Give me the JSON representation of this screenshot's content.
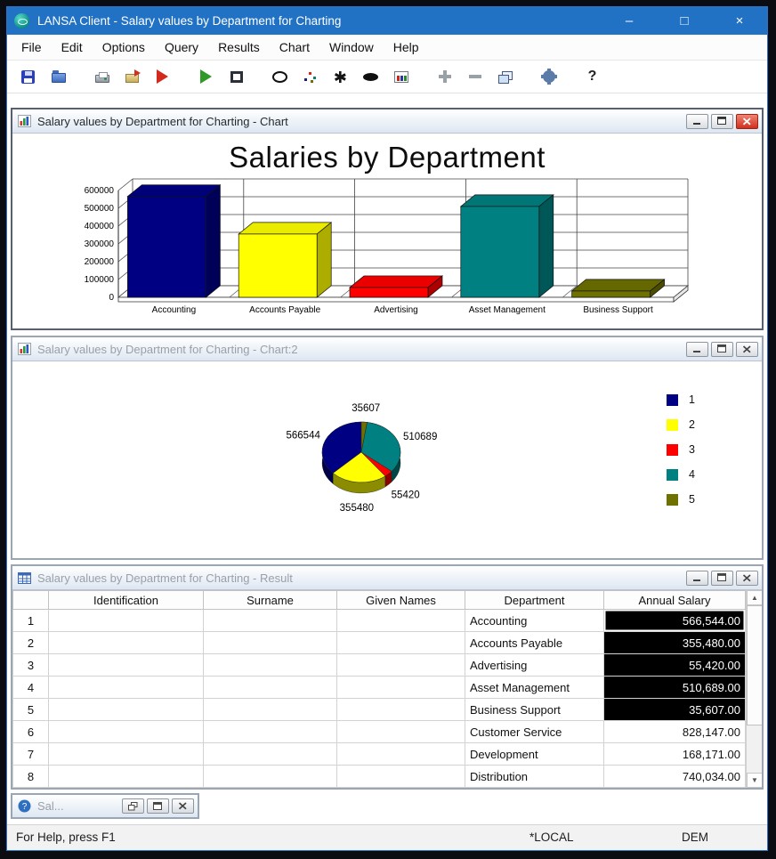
{
  "window": {
    "title": "LANSA Client - Salary values by Department for Charting",
    "buttons": {
      "minimize": "–",
      "maximize": "□",
      "close": "×"
    }
  },
  "menu_bar": {
    "items": [
      "File",
      "Edit",
      "Options",
      "Query",
      "Results",
      "Chart",
      "Window",
      "Help"
    ]
  },
  "toolbar": {
    "items": [
      {
        "name": "save",
        "icon": "floppy-icon"
      },
      {
        "name": "open",
        "icon": "folder-open-icon"
      },
      {
        "separator": true
      },
      {
        "name": "print",
        "icon": "printer-icon"
      },
      {
        "name": "export",
        "icon": "folder-export-icon"
      },
      {
        "name": "run-query",
        "icon": "run-triangle-icon"
      },
      {
        "separator": true
      },
      {
        "name": "play",
        "icon": "play-icon"
      },
      {
        "name": "stop",
        "icon": "stop-icon"
      },
      {
        "separator": true
      },
      {
        "name": "circle-chart",
        "icon": "circle-icon"
      },
      {
        "name": "scatter-chart",
        "icon": "scatter-icon"
      },
      {
        "name": "star-chart",
        "icon": "asterisk-icon"
      },
      {
        "name": "ellipse-chart",
        "icon": "ellipse-icon"
      },
      {
        "name": "chart-slide",
        "icon": "chart-slide-icon"
      },
      {
        "separator": true
      },
      {
        "name": "zoom-in",
        "icon": "plus-icon"
      },
      {
        "name": "zoom-out",
        "icon": "minus-icon"
      },
      {
        "name": "cascade",
        "icon": "cascade-icon"
      },
      {
        "separator": true
      },
      {
        "name": "settings",
        "icon": "gear-icon"
      },
      {
        "separator": true
      },
      {
        "name": "help",
        "icon": "question-icon"
      }
    ]
  },
  "chart_window": {
    "title": "Salary values by Department for Charting - Chart"
  },
  "chart2_window": {
    "title": "Salary values by Department for Charting - Chart:2"
  },
  "result_window": {
    "title": "Salary values by Department for Charting - Result",
    "columns": [
      "Identification",
      "Surname",
      "Given Names",
      "Department",
      "Annual Salary"
    ],
    "rows": [
      {
        "num": "1",
        "identification": "",
        "surname": "",
        "given_names": "",
        "department": "Accounting",
        "annual_salary": "566,544.00",
        "selected": true,
        "focused": true
      },
      {
        "num": "2",
        "identification": "",
        "surname": "",
        "given_names": "",
        "department": "Accounts Payable",
        "annual_salary": "355,480.00",
        "selected": true
      },
      {
        "num": "3",
        "identification": "",
        "surname": "",
        "given_names": "",
        "department": "Advertising",
        "annual_salary": "55,420.00",
        "selected": true
      },
      {
        "num": "4",
        "identification": "",
        "surname": "",
        "given_names": "",
        "department": "Asset Management",
        "annual_salary": "510,689.00",
        "selected": true
      },
      {
        "num": "5",
        "identification": "",
        "surname": "",
        "given_names": "",
        "department": "Business Support",
        "annual_salary": "35,607.00",
        "selected": true
      },
      {
        "num": "6",
        "identification": "",
        "surname": "",
        "given_names": "",
        "department": "Customer Service",
        "annual_salary": "828,147.00",
        "selected": false
      },
      {
        "num": "7",
        "identification": "",
        "surname": "",
        "given_names": "",
        "department": "Development",
        "annual_salary": "168,171.00",
        "selected": false
      },
      {
        "num": "8",
        "identification": "",
        "surname": "",
        "given_names": "",
        "department": "Distribution",
        "annual_salary": "740,034.00",
        "selected": false
      }
    ]
  },
  "minimized_window": {
    "title": "Sal..."
  },
  "status_bar": {
    "help_text": "For Help, press F1",
    "server": "*LOCAL",
    "partition": "DEM"
  },
  "chart_data": [
    {
      "type": "bar",
      "title": "Salaries by Department",
      "categories": [
        "Accounting",
        "Accounts Payable",
        "Advertising",
        "Asset Management",
        "Business Support"
      ],
      "values": [
        566544,
        355480,
        55420,
        510689,
        35607
      ],
      "colors": [
        "#000082",
        "#ffff00",
        "#ff0000",
        "#008080",
        "#6e7000"
      ],
      "xlabel": "",
      "ylabel": "",
      "ylim": [
        0,
        600000
      ],
      "yticks": [
        0,
        100000,
        200000,
        300000,
        400000,
        500000,
        600000
      ],
      "grid": true,
      "legend_position": "none"
    },
    {
      "type": "pie",
      "values": [
        566544,
        355480,
        55420,
        510689,
        35607
      ],
      "labels": [
        "566544",
        "355480",
        "55420",
        "510689",
        "35607"
      ],
      "legend": [
        "1",
        "2",
        "3",
        "4",
        "5"
      ],
      "colors": [
        "#000082",
        "#ffff00",
        "#ff0000",
        "#008080",
        "#6e7000"
      ],
      "legend_position": "right"
    }
  ]
}
